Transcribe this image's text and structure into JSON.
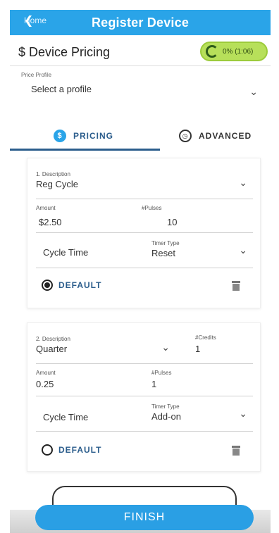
{
  "header": {
    "back_label": "Home",
    "title": "Register Device"
  },
  "subheader": {
    "title": "$ Device Pricing",
    "progress_text": "0% (1:06)"
  },
  "profile": {
    "label": "Price Profile",
    "value": "Select a profile"
  },
  "tabs": {
    "pricing": {
      "icon_glyph": "$",
      "label": "PRICING"
    },
    "advanced": {
      "icon_glyph": "◷",
      "label": "ADVANCED"
    }
  },
  "cards": [
    {
      "description_label": "1. Description",
      "description_value": "Reg Cycle",
      "amount_label": "Amount",
      "amount_value": "$2.50",
      "pulses_label": "#Pulses",
      "pulses_value": "10",
      "cycle_label": "Cycle Time",
      "timer_type_label": "Timer Type",
      "timer_type_value": "Reset",
      "default_label": "DEFAULT",
      "default_selected": true
    },
    {
      "description_label": "2. Description",
      "description_value": "Quarter",
      "credits_label": "#Credits",
      "credits_value": "1",
      "amount_label": "Amount",
      "amount_value": "0.25",
      "pulses_label": "#Pulses",
      "pulses_value": "1",
      "cycle_label": "Cycle Time",
      "timer_type_label": "Timer Type",
      "timer_type_value": "Add-on",
      "default_label": "DEFAULT",
      "default_selected": false
    }
  ],
  "finish_label": "FINISH",
  "colors": {
    "header_blue": "#2aa4e8",
    "accent_navy": "#2b5d8c",
    "progress_green": "#b7e05a",
    "finish_blue": "#2a9fe4"
  },
  "icons": [
    "chevron-left-icon",
    "refresh-icon",
    "dollar-icon",
    "clock-icon",
    "chevron-down-icon",
    "trash-icon",
    "radio-checked-icon",
    "radio-unchecked-icon"
  ]
}
